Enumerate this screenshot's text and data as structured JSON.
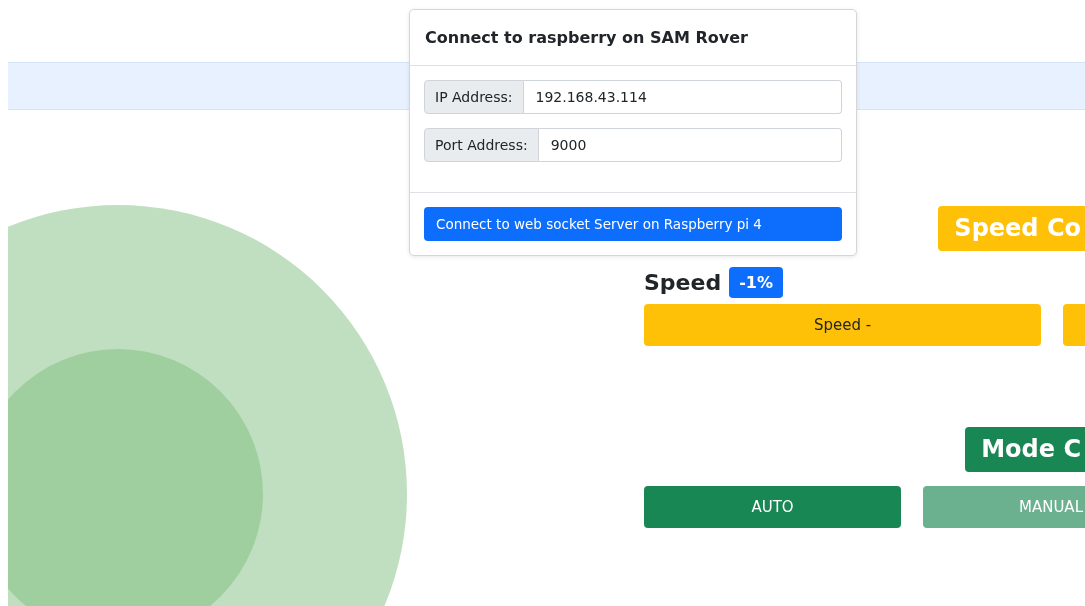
{
  "modal": {
    "title": "Connect to raspberry on SAM Rover",
    "fields": [
      {
        "label": "IP Address:",
        "value": "192.168.43.114"
      },
      {
        "label": "Port Address:",
        "value": "9000"
      }
    ],
    "button": "Connect to web socket Server on Raspberry pi 4"
  },
  "speed_control": {
    "title": "Speed Co",
    "label": "Speed",
    "value": "-1%",
    "buttons": [
      {
        "kind": "labeled",
        "label": "Speed -"
      },
      {
        "kind": "blank"
      }
    ]
  },
  "mode_control": {
    "title": "Mode C",
    "buttons": [
      {
        "label": "AUTO",
        "selected": true
      },
      {
        "label": "MANUAL",
        "selected": false
      }
    ]
  }
}
